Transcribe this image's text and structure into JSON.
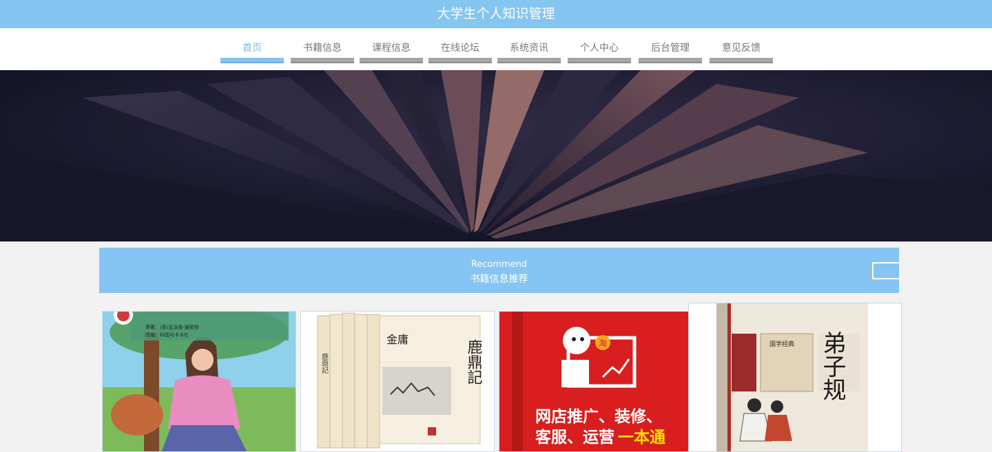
{
  "header": {
    "title": "大学生个人知识管理"
  },
  "nav": {
    "items": [
      {
        "label": "首页",
        "active": true
      },
      {
        "label": "书籍信息"
      },
      {
        "label": "课程信息"
      },
      {
        "label": "在线论坛"
      },
      {
        "label": "系统资讯"
      },
      {
        "label": "个人中心"
      },
      {
        "label": "后台管理"
      },
      {
        "label": "意见反馈"
      }
    ]
  },
  "recommend": {
    "title_en": "Recommend",
    "title_cn": "书籍信息推荐"
  },
  "books": [
    {
      "cover_text": [
        "票著：(英)瓦洛普·施密特",
        "改编：科图与卡卡社"
      ]
    },
    {
      "cover_text": [
        "金庸",
        "鹿鼎記",
        "鹿鼎記"
      ]
    },
    {
      "cover_text": [
        "淘",
        "网店推广、装修、",
        "客服、运营",
        "一本通"
      ]
    },
    {
      "cover_text": [
        "弟子规",
        "国学经典"
      ]
    }
  ],
  "colors": {
    "accent": "#85c5f2",
    "nav_active": "#7ab9e6"
  }
}
